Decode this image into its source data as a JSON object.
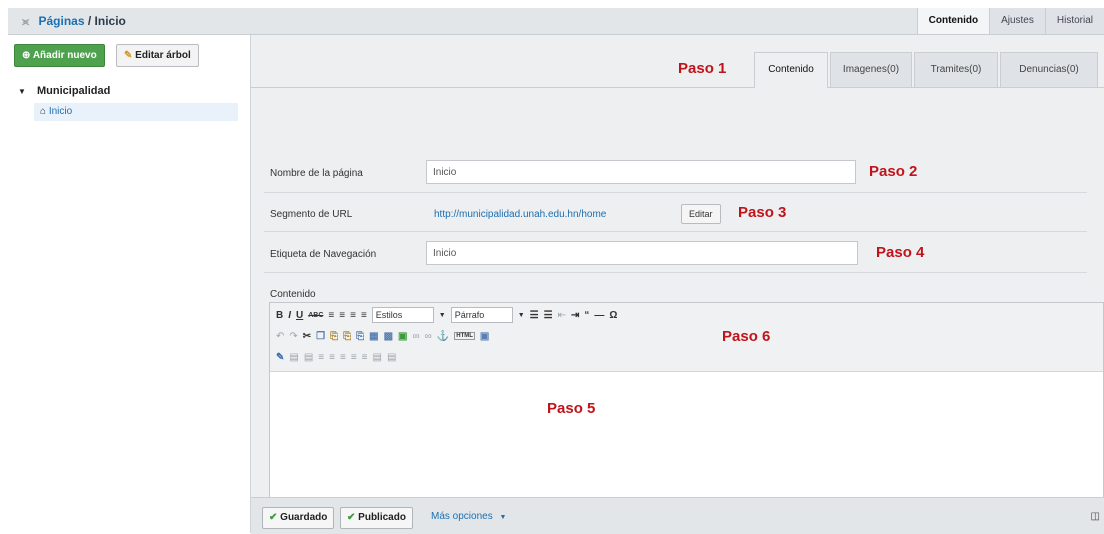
{
  "header": {
    "breadcrumb_root": "Páginas",
    "breadcrumb_sep": " / ",
    "breadcrumb_current": "Inicio",
    "tabs": [
      "Contenido",
      "Ajustes",
      "Historial"
    ]
  },
  "sidebar": {
    "add_label": "Añadir nuevo",
    "edit_tree_label": "Editar árbol",
    "tree_root": "Municipalidad",
    "tree_child": "Inicio"
  },
  "subtabs": [
    "Contenido",
    "Imagenes(0)",
    "Tramites(0)",
    "Denuncias(0)"
  ],
  "annotations": {
    "paso1": "Paso 1",
    "paso2": "Paso 2",
    "paso3": "Paso 3",
    "paso4": "Paso 4",
    "paso5": "Paso 5",
    "paso6": "Paso 6"
  },
  "form": {
    "name_label": "Nombre de la página",
    "name_value": "Inicio",
    "url_label": "Segmento de URL",
    "url_value": "http://municipalidad.unah.edu.hn/home",
    "edit_button": "Editar",
    "nav_label": "Etiqueta de Navegación",
    "nav_value": "Inicio",
    "content_label": "Contenido"
  },
  "editor": {
    "styles_select": "Estilos",
    "format_select": "Párrafo"
  },
  "footer": {
    "saved": "Guardado",
    "published": "Publicado",
    "more": "Más opciones"
  },
  "colors": {
    "paso": "#c0141b",
    "link": "#1d6fb0",
    "add_button": "#4ea24e"
  }
}
